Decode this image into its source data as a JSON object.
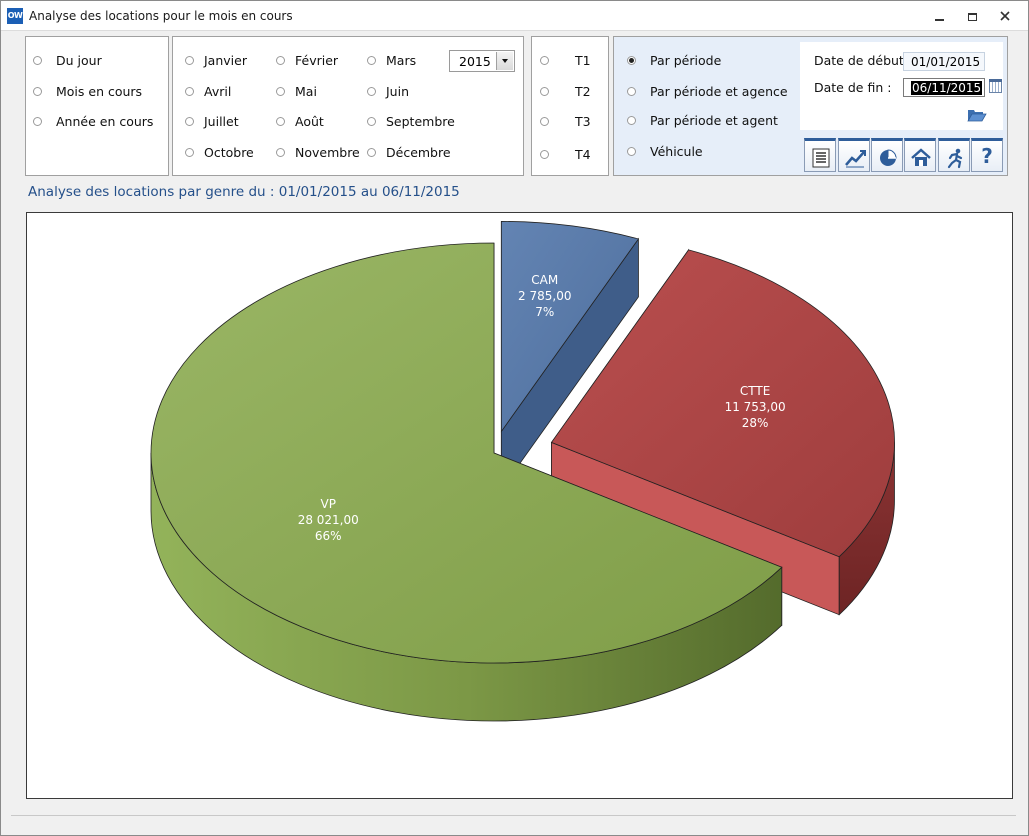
{
  "window": {
    "title": "Analyse des locations pour le mois en cours",
    "icon_text": "OW"
  },
  "range_options": [
    {
      "label": "Du jour",
      "checked": false
    },
    {
      "label": "Mois en cours",
      "checked": false
    },
    {
      "label": "Année en cours",
      "checked": false
    }
  ],
  "months": [
    {
      "label": "Janvier"
    },
    {
      "label": "Février"
    },
    {
      "label": "Mars"
    },
    {
      "label": "Avril"
    },
    {
      "label": "Mai"
    },
    {
      "label": "Juin"
    },
    {
      "label": "Juillet"
    },
    {
      "label": "Août"
    },
    {
      "label": "Septembre"
    },
    {
      "label": "Octobre"
    },
    {
      "label": "Novembre"
    },
    {
      "label": "Décembre"
    }
  ],
  "year_select": {
    "value": "2015"
  },
  "quarters": [
    {
      "label": "T1"
    },
    {
      "label": "T2"
    },
    {
      "label": "T3"
    },
    {
      "label": "T4"
    }
  ],
  "analysis_types": [
    {
      "label": "Par période",
      "checked": true
    },
    {
      "label": "Par période et agence",
      "checked": false
    },
    {
      "label": "Par période et agent",
      "checked": false
    },
    {
      "label": "Véhicule",
      "checked": false
    }
  ],
  "dates": {
    "start_label": "Date de début",
    "start_value": "01/01/2015",
    "end_label": "Date de fin :",
    "end_value": "06/11/2015"
  },
  "toolbar": {
    "icons": [
      "report-icon",
      "line-chart-icon",
      "pie-chart-icon",
      "home-icon",
      "exit-icon",
      "help-icon"
    ],
    "help_glyph": "?"
  },
  "chart_caption": "Analyse des locations par genre du : 01/01/2015 au 06/11/2015",
  "colors": {
    "accent_blue": "#2e5d9a",
    "vp": "#8faa55",
    "cam": "#5778a8",
    "ctte": "#b04848"
  },
  "chart_data": {
    "type": "pie",
    "title": "",
    "slices": [
      {
        "label": "CAM",
        "value": 2785.0,
        "value_text": "2 785,00",
        "pct": "7%"
      },
      {
        "label": "CTTE",
        "value": 11753.0,
        "value_text": "11 753,00",
        "pct": "28%"
      },
      {
        "label": "VP",
        "value": 28021.0,
        "value_text": "28 021,00",
        "pct": "66%"
      }
    ],
    "exploded": [
      "CAM",
      "CTTE"
    ],
    "three_d": true,
    "legend": "none"
  }
}
